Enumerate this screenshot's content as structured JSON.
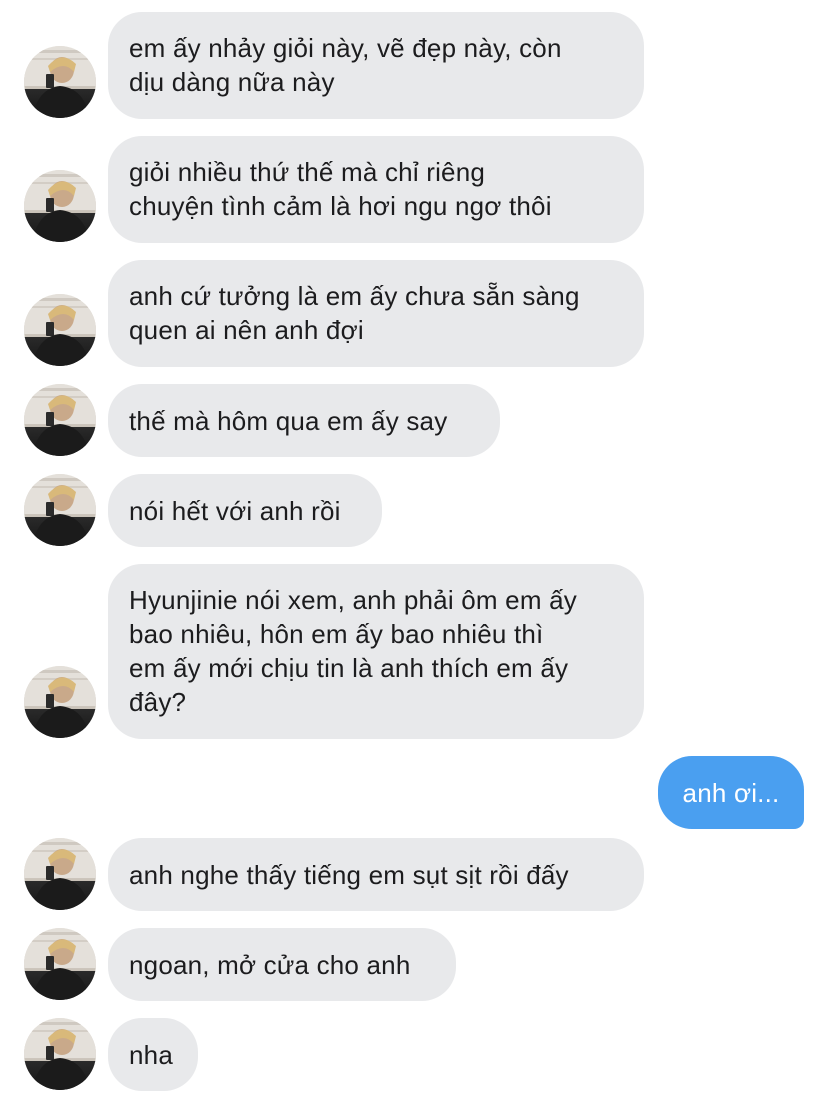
{
  "conversation": {
    "messages": [
      {
        "sender": "other",
        "text": "em ấy nhảy giỏi này, vẽ đẹp này, còn\ndịu dàng nữa này"
      },
      {
        "sender": "other",
        "text": "giỏi nhiều thứ thế mà chỉ riêng\nchuyện tình cảm là hơi ngu ngơ thôi"
      },
      {
        "sender": "other",
        "text": "anh cứ tưởng là em ấy chưa sẵn sàng\nquen ai nên anh đợi"
      },
      {
        "sender": "other",
        "text": "thế mà hôm qua em ấy say"
      },
      {
        "sender": "other",
        "text": "nói hết với anh rồi"
      },
      {
        "sender": "other",
        "text": "Hyunjinie nói xem, anh phải ôm em ấy\nbao nhiêu, hôn em ấy bao nhiêu thì\nem ấy mới chịu tin là anh thích em ấy\nđây?"
      },
      {
        "sender": "me",
        "text": "anh ơi..."
      },
      {
        "sender": "other",
        "text": "anh nghe thấy tiếng em sụt sịt rồi đấy"
      },
      {
        "sender": "other",
        "text": "ngoan, mở cửa cho anh"
      },
      {
        "sender": "other",
        "text": "nha"
      }
    ]
  },
  "colors": {
    "incoming_bubble": "#e8e9eb",
    "outgoing_bubble": "#4a9ff0",
    "incoming_text": "#1c1c1e",
    "outgoing_text": "#ffffff"
  },
  "icons": {
    "avatar": "profile-photo-avatar"
  }
}
